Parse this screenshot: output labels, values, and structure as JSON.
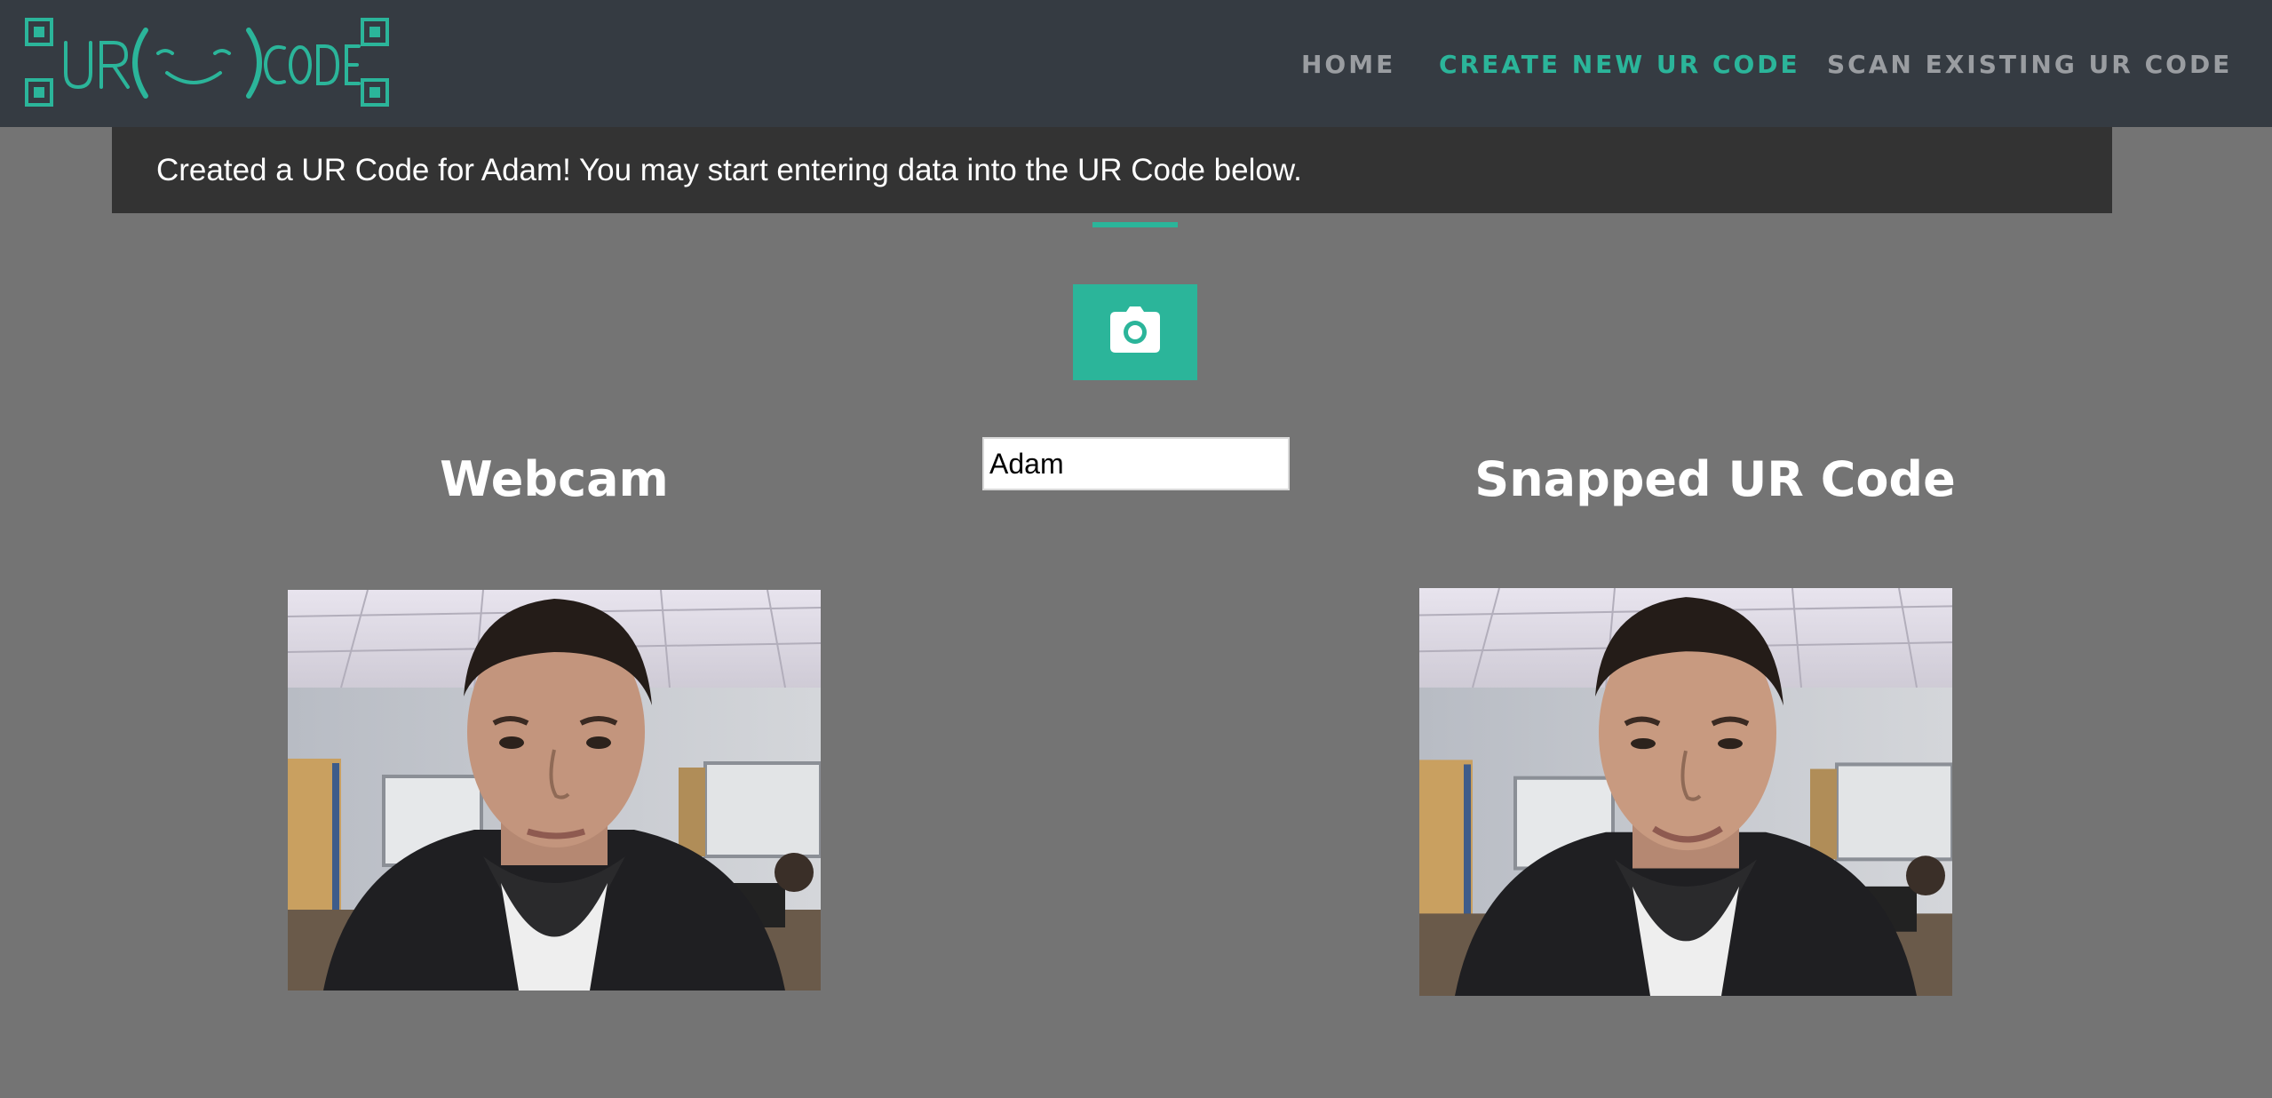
{
  "app": {
    "logo_text": "UR CODE",
    "brand_color": "#2bb59a"
  },
  "nav": {
    "items": [
      {
        "label": "HOME",
        "active": false
      },
      {
        "label": "CREATE NEW UR CODE",
        "active": true
      },
      {
        "label": "SCAN EXISTING UR CODE",
        "active": false
      }
    ]
  },
  "alert": {
    "message": "Created a UR Code for Adam! You may start entering data into the UR Code below."
  },
  "controls": {
    "snap_icon": "camera-icon",
    "name_value": "Adam"
  },
  "columns": {
    "webcam_title": "Webcam",
    "snapped_title": "Snapped UR Code"
  }
}
